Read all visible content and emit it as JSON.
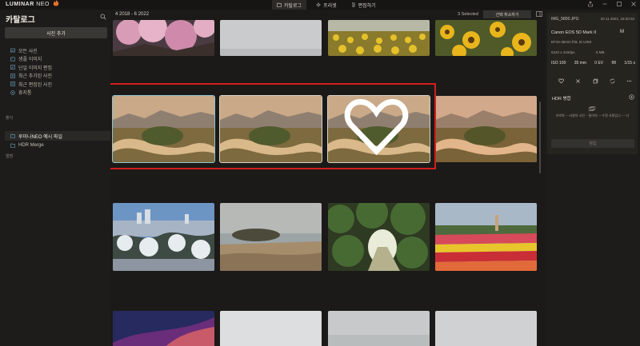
{
  "app": {
    "logo_text_bold": "LUMINAR",
    "logo_text_light": "NEO"
  },
  "top_nav": {
    "catalog": "카탈로그",
    "presets": "프리셋",
    "edit": "편집하기"
  },
  "sidebar": {
    "title": "카탈로그",
    "add_photo": "사진 추가",
    "items": [
      {
        "label": "모든 사진",
        "icon": "photos-icon"
      },
      {
        "label": "생플 이미지",
        "icon": "image-icon"
      },
      {
        "label": "단일 이미지 편집",
        "icon": "single-edit-icon"
      },
      {
        "label": "최근 추가된 사진",
        "icon": "recent-added-icon"
      },
      {
        "label": "최근 편집된 사진",
        "icon": "recent-edited-icon"
      },
      {
        "label": "휴지통",
        "icon": "trash-icon"
      }
    ],
    "folders_label": "폴더",
    "folders": [
      {
        "label": "루미나NEO 예시 파일",
        "active": true
      },
      {
        "label": "HDR Merge",
        "active": false
      }
    ],
    "albums_label": "앨범"
  },
  "main": {
    "date_range": "4 2018 - 6 2022",
    "selected_count": "3 Selected",
    "cancel_selection": "선택 취소하기"
  },
  "info_panel": {
    "filename": "IMG_5800.JPG",
    "datetime": "20 11 2021, 16:20:32",
    "camera": "Canon EOS 5D Mark II",
    "badge": "M",
    "lens": "EF16-35mm f/4L IS USM",
    "resolution": "6240 x 4160px",
    "filesize": "6 MB",
    "exif": [
      "ISO 100",
      "35 mm",
      "0 EV",
      "f/8",
      "1/15 s"
    ]
  },
  "hdr_panel": {
    "title": "HDR 병합",
    "message": "프로파 ~~사항의 사진 ~ 물이의 ~~수정 사항입니 ~~ 다",
    "merge_button": "병합"
  },
  "colors": {
    "background": "#1b1a18",
    "selection_box": "#d21e1e",
    "accent_outline": "#8ec4cf"
  }
}
